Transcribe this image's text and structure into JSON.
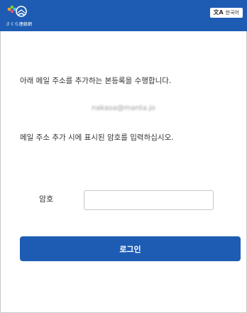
{
  "header": {
    "logo_icon": "sakura-renraku-logo-icon",
    "logo_text": "さくら連絡網",
    "language_button": {
      "icon": "translate-icon",
      "icon_glyph": "文A",
      "label": "한국어"
    },
    "background_color": "#1e5cb3"
  },
  "main": {
    "instruction_text": "아래 메일 주소를 추가하는 본등록을 수행합니다.",
    "email": "nakasa@manta.jo",
    "password_instruction": "메일 주소 추가 시에 표시된 암호를 입력하십시오.",
    "password_label": "암호",
    "password_value": "",
    "login_button_label": "로그인",
    "accent_color": "#1e5cb3"
  }
}
